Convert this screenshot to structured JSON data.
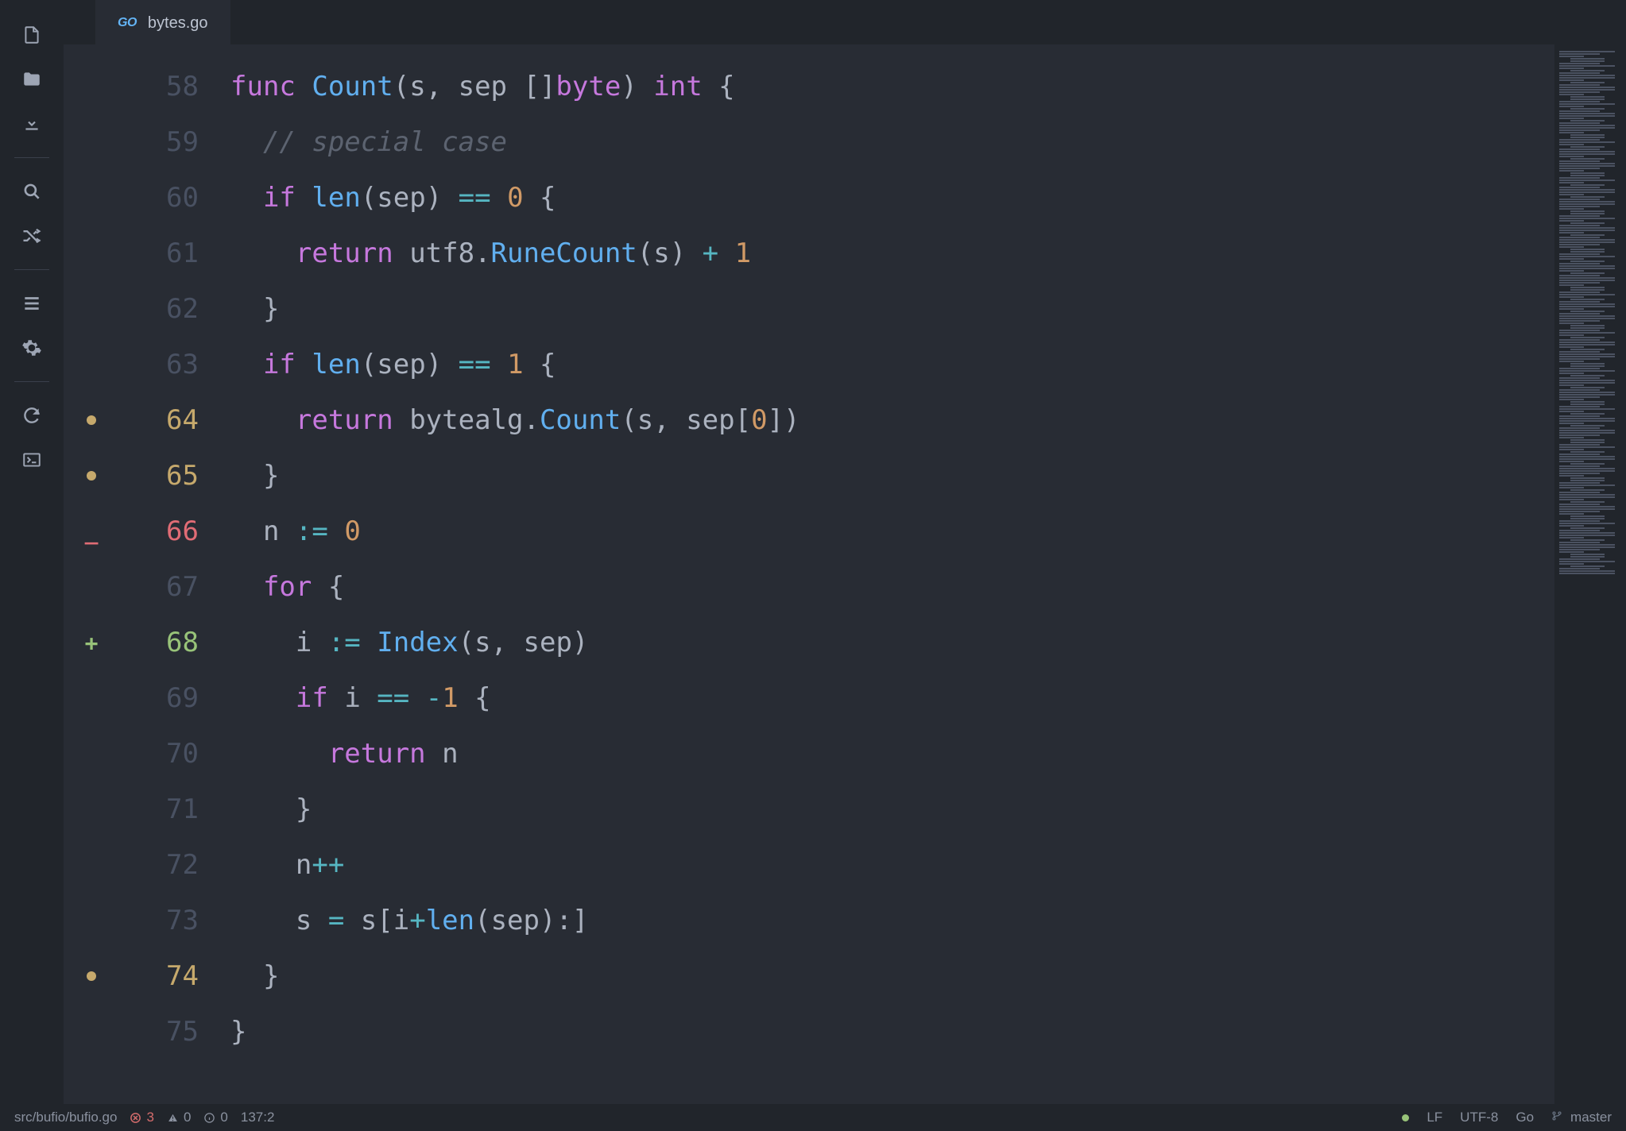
{
  "tab": {
    "lang_label": "GO",
    "filename": "bytes.go"
  },
  "activity": {
    "new_file": "new-file",
    "folder": "folder",
    "download": "download",
    "search": "search",
    "shuffle": "shuffle",
    "menu": "menu",
    "settings": "settings",
    "reload": "reload",
    "terminal": "terminal"
  },
  "code": {
    "lines": [
      {
        "n": 58,
        "marker": "",
        "tokens": [
          [
            "kw",
            "func "
          ],
          [
            "fn",
            "Count"
          ],
          [
            "pi",
            "(s, sep []"
          ],
          [
            "kw",
            "byte"
          ],
          [
            "pi",
            ") "
          ],
          [
            "kw",
            "int"
          ],
          [
            "pi",
            " {"
          ]
        ]
      },
      {
        "n": 59,
        "marker": "",
        "tokens": [
          [
            "pi",
            "  "
          ],
          [
            "cm",
            "// special case"
          ]
        ]
      },
      {
        "n": 60,
        "marker": "",
        "tokens": [
          [
            "pi",
            "  "
          ],
          [
            "kw",
            "if"
          ],
          [
            "pi",
            " "
          ],
          [
            "fn",
            "len"
          ],
          [
            "pi",
            "(sep) "
          ],
          [
            "op",
            "=="
          ],
          [
            "pi",
            " "
          ],
          [
            "nm",
            "0"
          ],
          [
            "pi",
            " {"
          ]
        ]
      },
      {
        "n": 61,
        "marker": "",
        "tokens": [
          [
            "pi",
            "    "
          ],
          [
            "kw",
            "return"
          ],
          [
            "pi",
            " utf8."
          ],
          [
            "fn",
            "RuneCount"
          ],
          [
            "pi",
            "(s) "
          ],
          [
            "op",
            "+"
          ],
          [
            "pi",
            " "
          ],
          [
            "nm",
            "1"
          ]
        ]
      },
      {
        "n": 62,
        "marker": "",
        "tokens": [
          [
            "pi",
            "  }"
          ]
        ]
      },
      {
        "n": 63,
        "marker": "",
        "tokens": [
          [
            "pi",
            "  "
          ],
          [
            "kw",
            "if"
          ],
          [
            "pi",
            " "
          ],
          [
            "fn",
            "len"
          ],
          [
            "pi",
            "(sep) "
          ],
          [
            "op",
            "=="
          ],
          [
            "pi",
            " "
          ],
          [
            "nm",
            "1"
          ],
          [
            "pi",
            " {"
          ]
        ]
      },
      {
        "n": 64,
        "marker": "dot",
        "tokens": [
          [
            "pi",
            "    "
          ],
          [
            "kw",
            "return"
          ],
          [
            "pi",
            " bytealg."
          ],
          [
            "fn",
            "Count"
          ],
          [
            "pi",
            "(s, sep["
          ],
          [
            "nm",
            "0"
          ],
          [
            "pi",
            "])"
          ]
        ]
      },
      {
        "n": 65,
        "marker": "dot",
        "tokens": [
          [
            "pi",
            "  }"
          ]
        ]
      },
      {
        "n": 66,
        "marker": "del",
        "tokens": [
          [
            "pi",
            "  n "
          ],
          [
            "op",
            ":="
          ],
          [
            "pi",
            " "
          ],
          [
            "nm",
            "0"
          ]
        ]
      },
      {
        "n": 67,
        "marker": "",
        "tokens": [
          [
            "pi",
            "  "
          ],
          [
            "kw",
            "for"
          ],
          [
            "pi",
            " {"
          ]
        ]
      },
      {
        "n": 68,
        "marker": "add",
        "tokens": [
          [
            "pi",
            "    i "
          ],
          [
            "op",
            ":="
          ],
          [
            "pi",
            " "
          ],
          [
            "fn",
            "Index"
          ],
          [
            "pi",
            "(s, sep)"
          ]
        ]
      },
      {
        "n": 69,
        "marker": "",
        "tokens": [
          [
            "pi",
            "    "
          ],
          [
            "kw",
            "if"
          ],
          [
            "pi",
            " i "
          ],
          [
            "op",
            "=="
          ],
          [
            "pi",
            " "
          ],
          [
            "op",
            "-"
          ],
          [
            "nm",
            "1"
          ],
          [
            "pi",
            " {"
          ]
        ]
      },
      {
        "n": 70,
        "marker": "",
        "tokens": [
          [
            "pi",
            "      "
          ],
          [
            "kw",
            "return"
          ],
          [
            "pi",
            " n"
          ]
        ]
      },
      {
        "n": 71,
        "marker": "",
        "tokens": [
          [
            "pi",
            "    }"
          ]
        ]
      },
      {
        "n": 72,
        "marker": "",
        "tokens": [
          [
            "pi",
            "    n"
          ],
          [
            "op",
            "++"
          ]
        ]
      },
      {
        "n": 73,
        "marker": "",
        "tokens": [
          [
            "pi",
            "    s "
          ],
          [
            "op",
            "="
          ],
          [
            "pi",
            " s[i"
          ],
          [
            "op",
            "+"
          ],
          [
            "fn",
            "len"
          ],
          [
            "pi",
            "(sep):]"
          ]
        ]
      },
      {
        "n": 74,
        "marker": "dot",
        "tokens": [
          [
            "pi",
            "  }"
          ]
        ]
      },
      {
        "n": 75,
        "marker": "",
        "tokens": [
          [
            "pi",
            "}"
          ]
        ]
      }
    ]
  },
  "status": {
    "path": "src/bufio/bufio.go",
    "errors": "3",
    "warnings": "0",
    "info": "0",
    "cursor": "137:2",
    "eol": "LF",
    "encoding": "UTF-8",
    "lang": "Go",
    "branch": "master"
  }
}
